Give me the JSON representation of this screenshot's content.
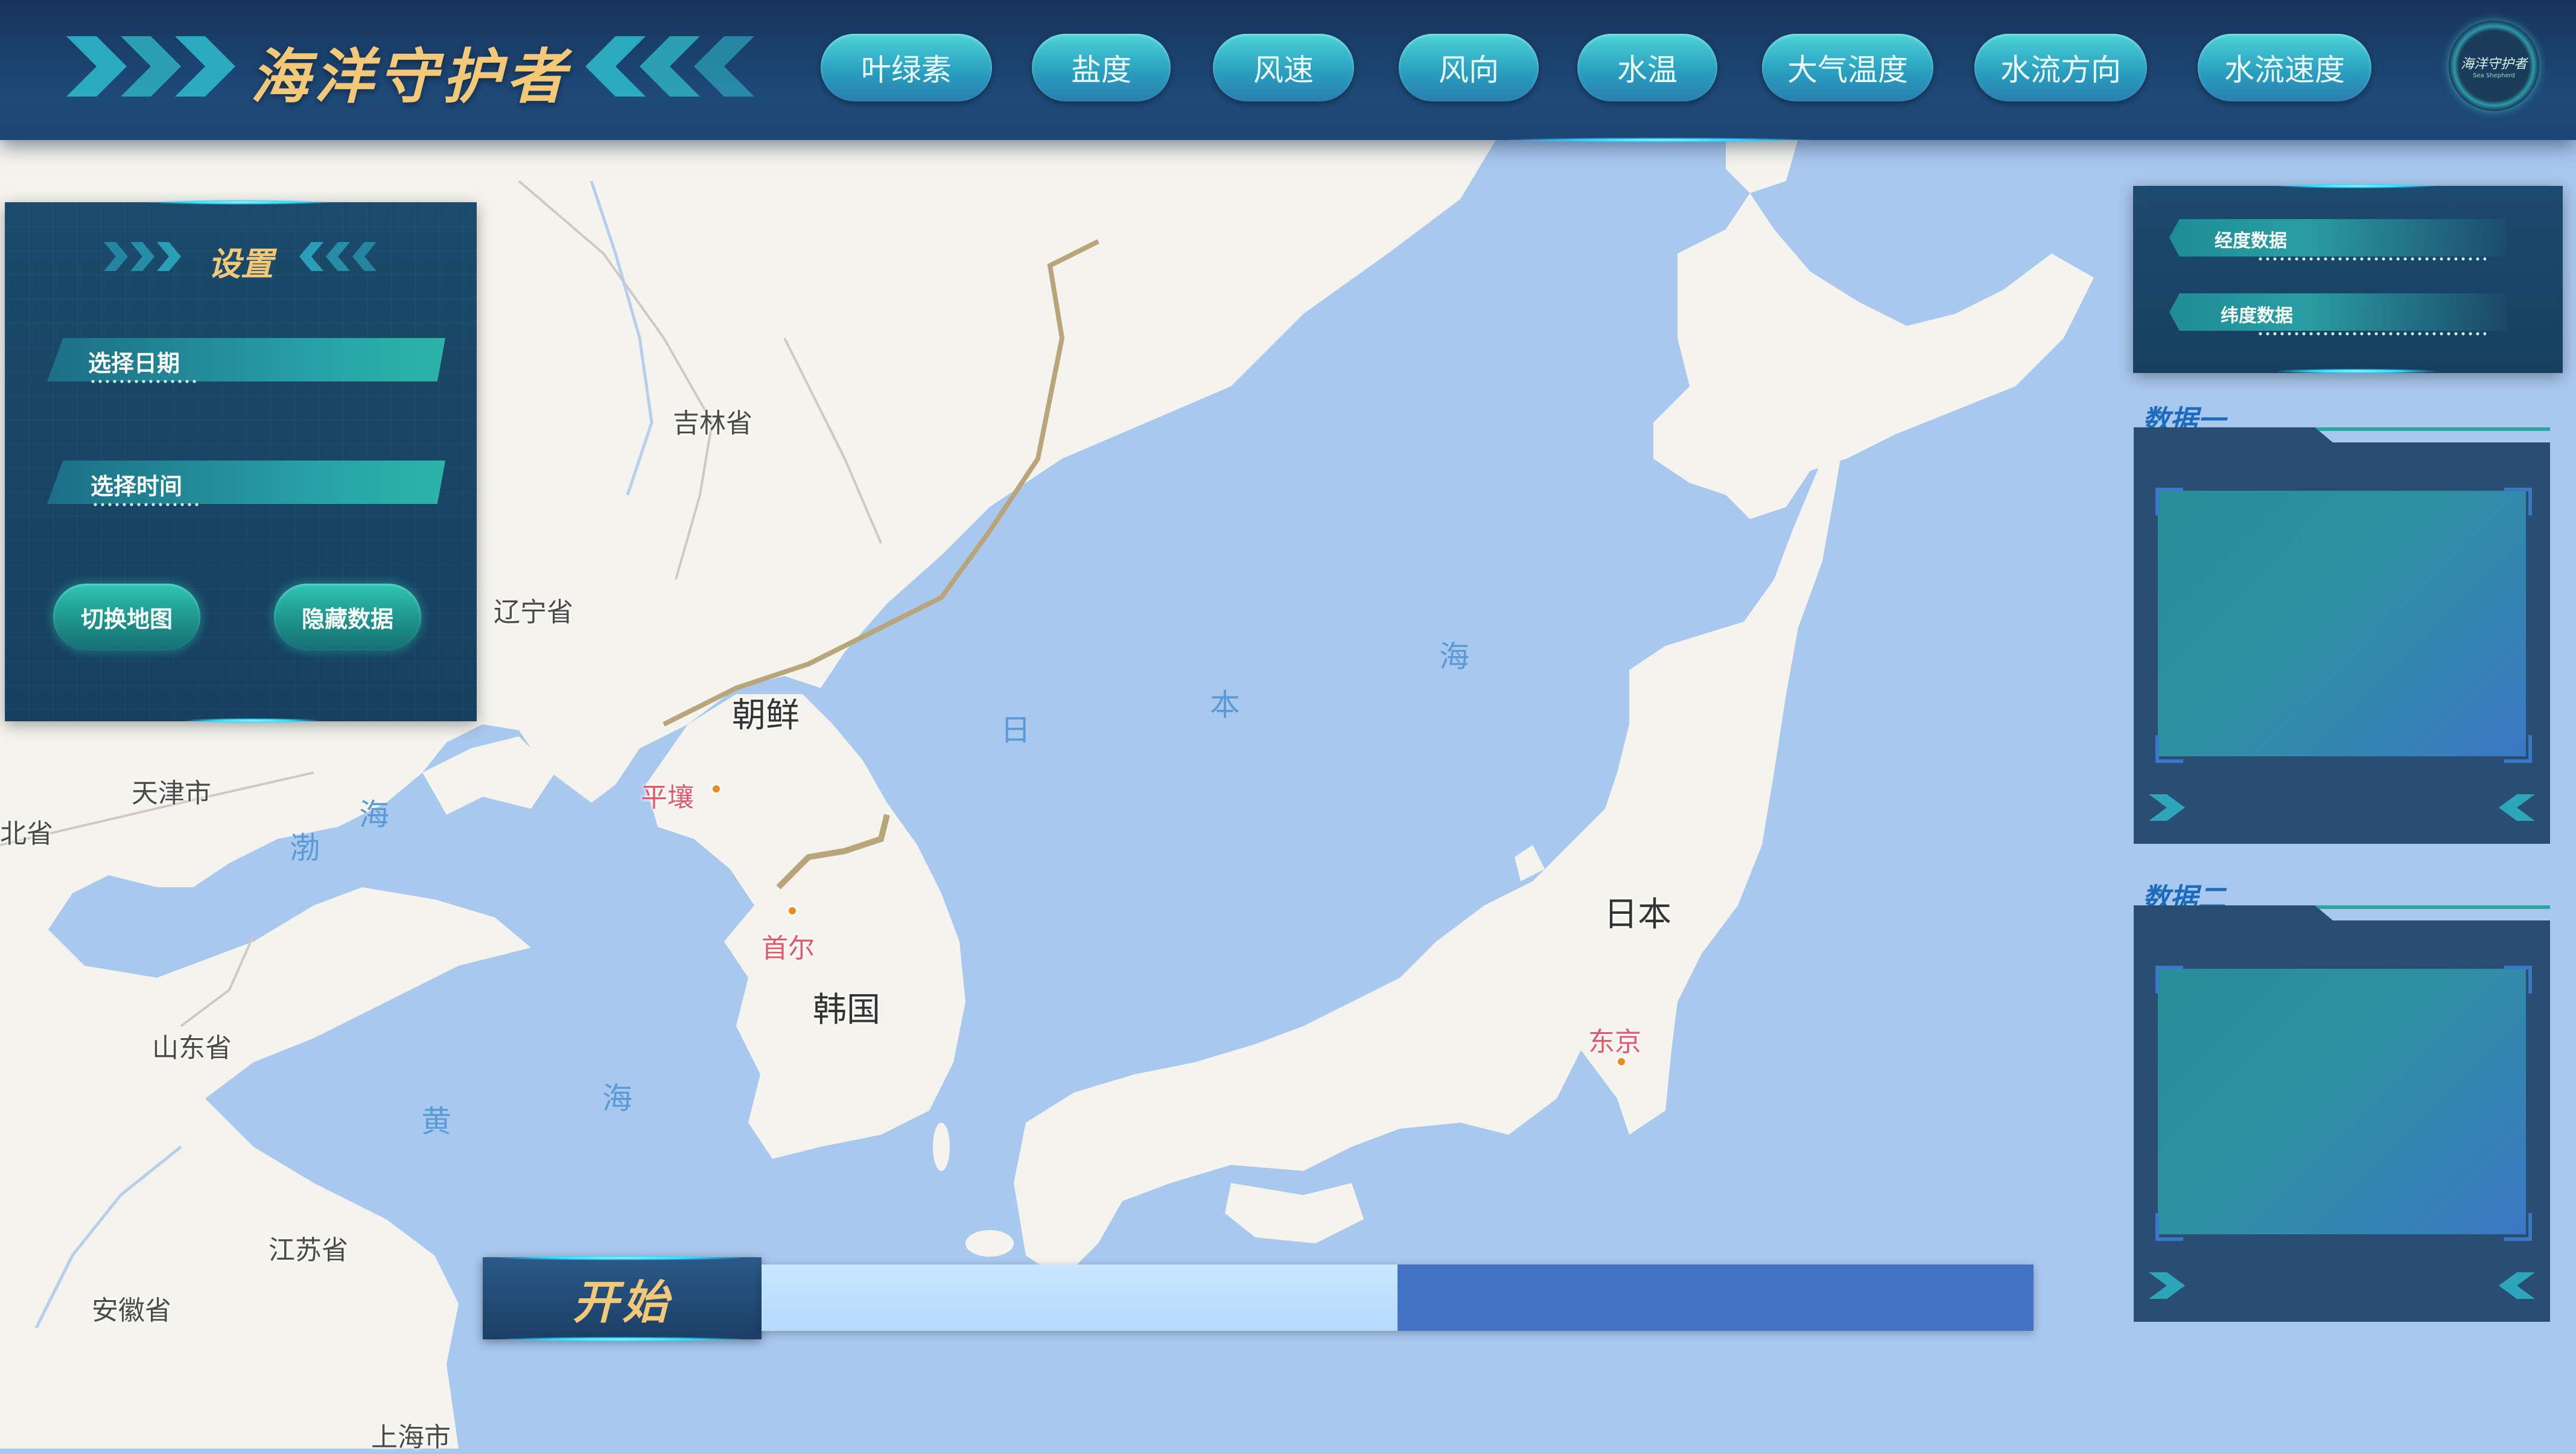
{
  "header": {
    "title": "海洋守护者",
    "nav": [
      "叶绿素",
      "盐度",
      "风速",
      "风向",
      "水温",
      "大气温度",
      "水流方向",
      "水流速度"
    ],
    "logo_text": "海洋守护者",
    "logo_sub": "Sea Shepherd"
  },
  "settings": {
    "title": "设置",
    "select_date": "选择日期",
    "select_time": "选择时间",
    "switch_map": "切换地图",
    "hide_data": "隐藏数据"
  },
  "coords": {
    "longitude": "经度数据",
    "latitude": "纬度数据"
  },
  "data_panels": [
    "数据一",
    "数据二"
  ],
  "playback": {
    "start_label": "开始",
    "progress": 0.5
  },
  "map": {
    "labels": {
      "jilin": "吉林省",
      "liaoning": "辽宁省",
      "tianjin": "天津市",
      "hebei": "北省",
      "shandong": "山东省",
      "jiangsu": "江苏省",
      "anhui": "安徽省",
      "shanghai": "上海市",
      "nk": "朝鲜",
      "sk": "韩国",
      "japan": "日本",
      "pyongyang": "平壤",
      "seoul": "首尔",
      "tokyo": "东京",
      "sea_ri": "日",
      "sea_ben": "本",
      "sea_hai1": "海",
      "bo": "渤",
      "bo_hai": "海",
      "huang": "黄",
      "huang_hai": "海"
    }
  },
  "colors": {
    "accent_gold": "#f3c979",
    "header_bg": "#1e4a78",
    "teal_button": "#2aa0c0",
    "ocean": "#a9c8ee",
    "land": "#f4f3ee",
    "progress_fill": "#b4daff",
    "progress_track": "#4473c5"
  }
}
